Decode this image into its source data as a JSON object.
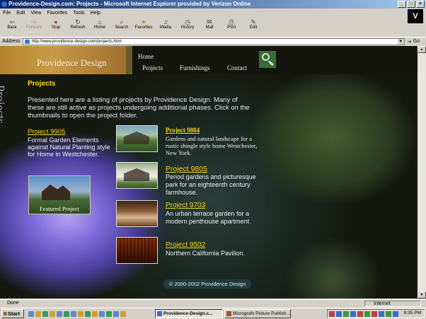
{
  "window": {
    "title": "Providence-Design.com: Projects - Microsoft Internet Explorer provided by Verizon Online",
    "logo_letter": "V"
  },
  "menu": [
    "File",
    "Edit",
    "View",
    "Favorites",
    "Tools",
    "Help"
  ],
  "toolbar": [
    {
      "label": "Back",
      "icon": "back-arrow-icon",
      "enabled": true
    },
    {
      "label": "Forward",
      "icon": "forward-arrow-icon",
      "enabled": false
    },
    {
      "label": "Stop",
      "icon": "stop-icon",
      "enabled": true
    },
    {
      "label": "Refresh",
      "icon": "refresh-icon",
      "enabled": true
    },
    {
      "label": "Home",
      "icon": "home-icon",
      "enabled": true
    },
    {
      "label": "Search",
      "icon": "search-icon",
      "enabled": true
    },
    {
      "label": "Favorites",
      "icon": "favorites-icon",
      "enabled": true
    },
    {
      "label": "Media",
      "icon": "media-icon",
      "enabled": true
    },
    {
      "label": "History",
      "icon": "history-icon",
      "enabled": true
    },
    {
      "label": "Mail",
      "icon": "mail-icon",
      "enabled": true
    },
    {
      "label": "Print",
      "icon": "print-icon",
      "enabled": true
    },
    {
      "label": "Edit",
      "icon": "edit-icon",
      "enabled": true
    }
  ],
  "address": {
    "label": "Address",
    "url": "http://www.providence-design.com/projects.html",
    "go_label": "Go"
  },
  "site": {
    "logo": "Providence Design",
    "nav": {
      "home": "Home",
      "projects": "Projects",
      "furnishings": "Furnishings",
      "contact": "Contact"
    },
    "side_title": "Projects",
    "section_title": "Projects",
    "intro": "Presented here are a listing of projects by Providence Design. Many of these are still active as projects undergoing additional phases. Click on the thumbnails to open the project folder.",
    "featured": {
      "link": "Project 9905",
      "description": "Formal Garden Elements against Natural Planting style for Home in Westchester.",
      "image_label": "Featured Project"
    },
    "projects": [
      {
        "link": "Project 9804",
        "description": "Gardens and natural landscape for a rustic shingle style home Westchester, New York."
      },
      {
        "link": "Project 9805",
        "description": "Period gardens and picturesque park for an eighteenth century farmhouse."
      },
      {
        "link": "Project 9703",
        "description": "An urban terrace garden for a modern penthouse apartment."
      },
      {
        "link": "Project 9502",
        "description": "Northern California Pavilion."
      }
    ],
    "copyright": "© 2000-2002 Providence Design",
    "colors": {
      "link": "#f5d61a",
      "logo_band": "#b5832c",
      "text": "#e8e8f8"
    }
  },
  "status": {
    "text": "Done",
    "zone": "Internet"
  },
  "taskbar": {
    "start": "Start",
    "tasks": [
      "Providence-Design.c...",
      "Micrografx Picture Publish..."
    ],
    "clock": "8:35 PM"
  }
}
